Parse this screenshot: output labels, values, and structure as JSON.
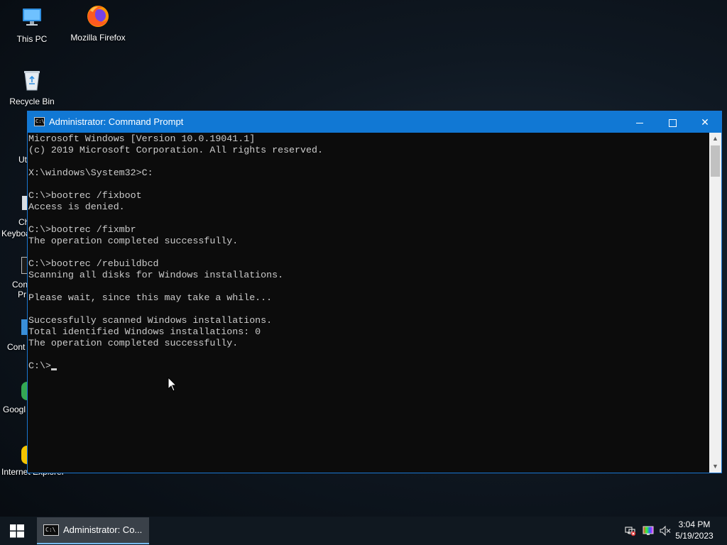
{
  "desktop": {
    "icons": [
      {
        "label": "This PC"
      },
      {
        "label": "Mozilla Firefox"
      },
      {
        "label": "Recycle Bin"
      }
    ],
    "partial_icons": [
      {
        "label": "Ut"
      },
      {
        "label": "Ch"
      },
      {
        "label": "Keyboa"
      },
      {
        "label": "Con"
      },
      {
        "label": "Pr"
      },
      {
        "label": "Cont"
      },
      {
        "label": "Googl"
      },
      {
        "label": "Internet Explorer"
      }
    ]
  },
  "window": {
    "title": "Administrator: Command Prompt",
    "icon_glyph": "C:\\",
    "min_label": "",
    "close_glyph": "✕"
  },
  "console": {
    "text": "Microsoft Windows [Version 10.0.19041.1]\n(c) 2019 Microsoft Corporation. All rights reserved.\n\nX:\\windows\\System32>C:\n\nC:\\>bootrec /fixboot\nAccess is denied.\n\nC:\\>bootrec /fixmbr\nThe operation completed successfully.\n\nC:\\>bootrec /rebuildbcd\nScanning all disks for Windows installations.\n\nPlease wait, since this may take a while...\n\nSuccessfully scanned Windows installations.\nTotal identified Windows installations: 0\nThe operation completed successfully.\n\n",
    "prompt": "C:\\>"
  },
  "taskbar": {
    "active_item": "Administrator: Co...",
    "clock_time": "3:04 PM",
    "clock_date": "5/19/2023"
  },
  "colors": {
    "titlebar": "#1178d4",
    "console_bg": "#0c0c0c",
    "console_fg": "#cccccc",
    "taskbar": "#101820"
  }
}
